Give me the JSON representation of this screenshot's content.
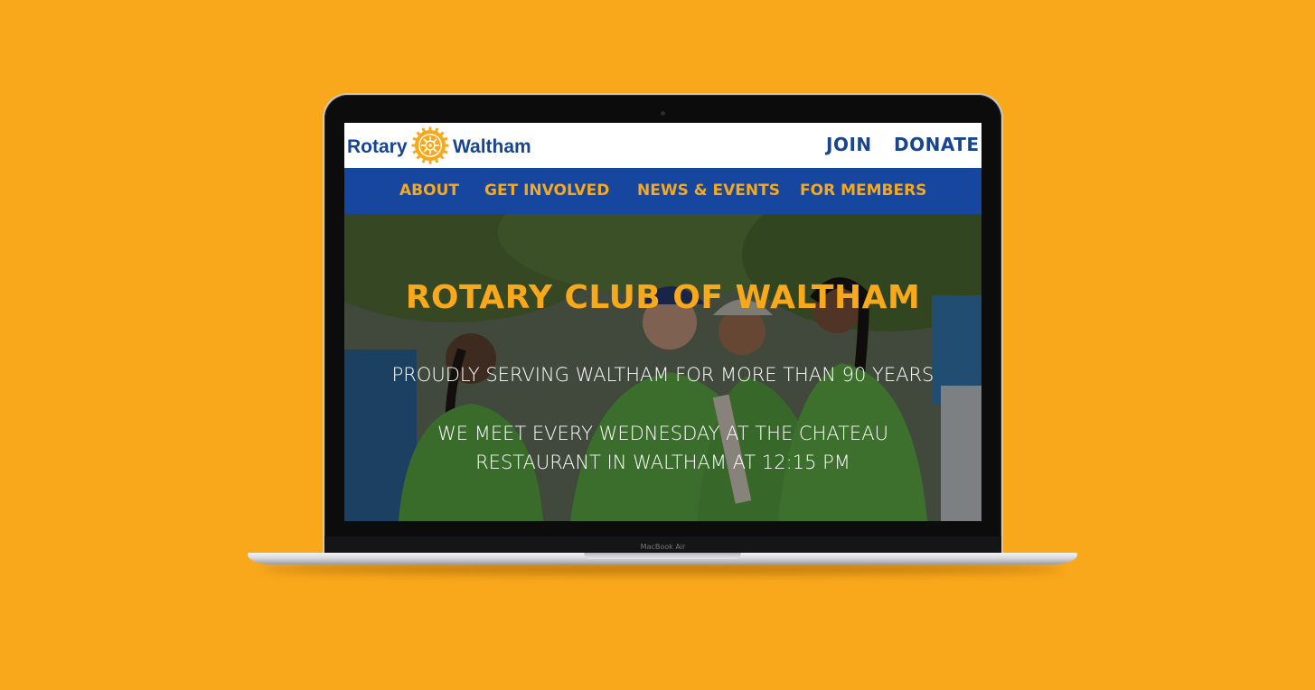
{
  "device": {
    "label": "MacBook Air"
  },
  "site": {
    "logo": {
      "left_text": "Rotary",
      "right_text": "Waltham"
    },
    "top_links": {
      "join": "JOIN",
      "donate": "DONATE"
    },
    "nav": {
      "items": [
        {
          "label": "ABOUT"
        },
        {
          "label": "GET INVOLVED"
        },
        {
          "label": "NEWS & EVENTS"
        },
        {
          "label": "FOR MEMBERS"
        }
      ]
    },
    "hero": {
      "title": "ROTARY CLUB OF WALTHAM",
      "subtitle": "PROUDLY SERVING WALTHAM FOR MORE THAN 90 YEARS",
      "meeting_line1": "WE MEET EVERY WEDNESDAY AT THE CHATEAU",
      "meeting_line2": "RESTAURANT IN WALTHAM AT 12:15 PM"
    }
  },
  "colors": {
    "background": "#f9a81b",
    "rotary_blue": "#17458f",
    "nav_blue": "#17469e",
    "rotary_gold": "#f7a81b"
  }
}
